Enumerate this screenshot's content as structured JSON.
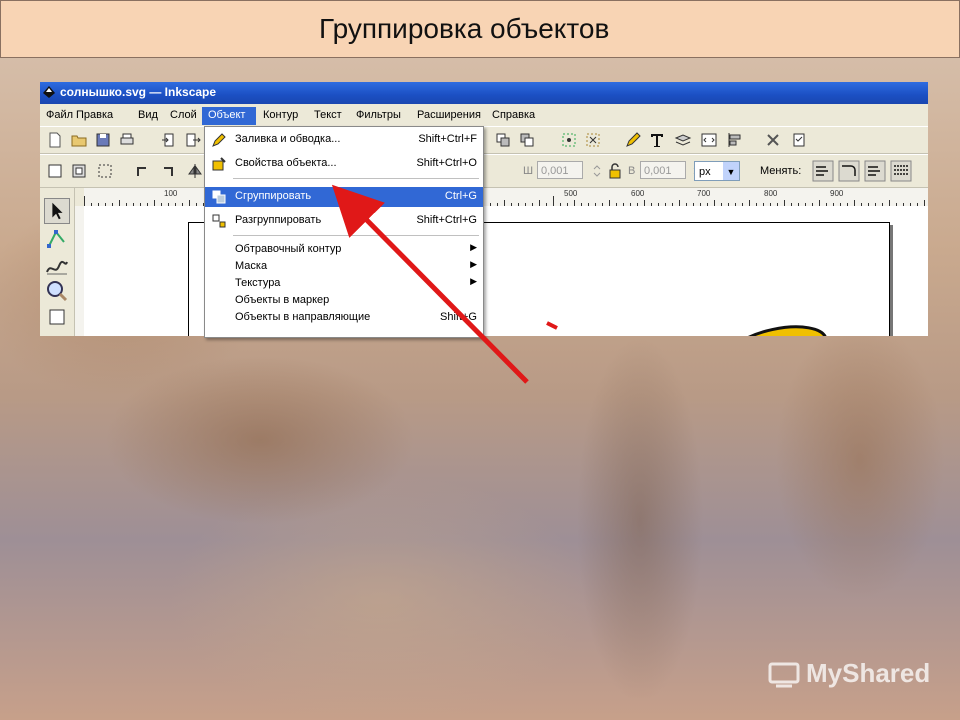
{
  "page_title": "Группировка объектов",
  "window": {
    "title": "солнышко.svg — Inkscape"
  },
  "menubar": [
    "Файл",
    "Правка",
    "Вид",
    "Слой",
    "Объект",
    "Контур",
    "Текст",
    "Фильтры",
    "Расширения",
    "Справка"
  ],
  "toolbar2": {
    "w_label": "Ш",
    "w_value": "0,001",
    "h_label": "В",
    "h_value": "0,001",
    "units": "px",
    "change_label": "Менять:"
  },
  "ruler_labels": [
    "100",
    "0",
    "500",
    "600",
    "700",
    "800",
    "900"
  ],
  "dropdown": {
    "items": [
      {
        "label": "Заливка и обводка...",
        "shortcut": "Shift+Ctrl+F",
        "icon": "fill-stroke-icon"
      },
      {
        "label": "Свойства объекта...",
        "shortcut": "Shift+Ctrl+O",
        "icon": "object-properties-icon"
      },
      {
        "label": "Сгруппировать",
        "shortcut": "Ctrl+G",
        "icon": "group-icon",
        "selected": true
      },
      {
        "label": "Разгруппировать",
        "shortcut": "Shift+Ctrl+G",
        "icon": "ungroup-icon"
      },
      {
        "label": "Обтравочный контур",
        "submenu": true
      },
      {
        "label": "Маска",
        "submenu": true
      },
      {
        "label": "Текстура",
        "submenu": true
      },
      {
        "label": "Объекты в маркер"
      },
      {
        "label": "Объекты в направляющие",
        "shortcut": "Shift+G"
      }
    ]
  },
  "watermark": "MyShared",
  "colors": {
    "highlight": "#3168d5",
    "arrow": "#e01818",
    "sun_petal": "#f0c000"
  }
}
